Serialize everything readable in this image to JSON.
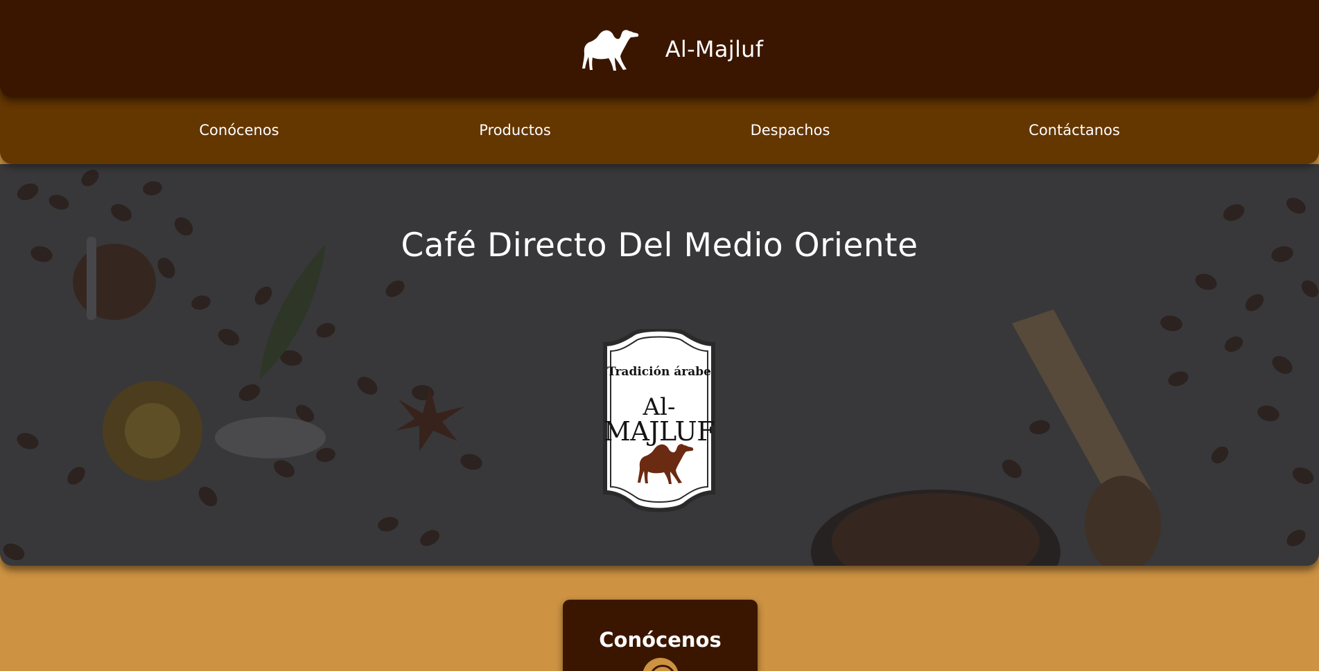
{
  "header": {
    "brand_name": "Al-Majluf",
    "logo_icon": "camel-icon"
  },
  "nav": {
    "items": [
      {
        "label": "Conócenos"
      },
      {
        "label": "Productos"
      },
      {
        "label": "Despachos"
      },
      {
        "label": "Contáctanos"
      }
    ]
  },
  "hero": {
    "title": "Café Directo Del Medio Oriente",
    "badge": {
      "tagline": "Tradición árabe",
      "line1": "Al-",
      "line2": "MAJLUF"
    }
  },
  "section": {
    "title": "Conócenos"
  },
  "colors": {
    "header_bg": "#3a1600",
    "nav_bg": "#643600",
    "page_bg": "#cd9242",
    "hero_overlay": "#3d3d3f",
    "camel_brown": "#6b2a12"
  }
}
